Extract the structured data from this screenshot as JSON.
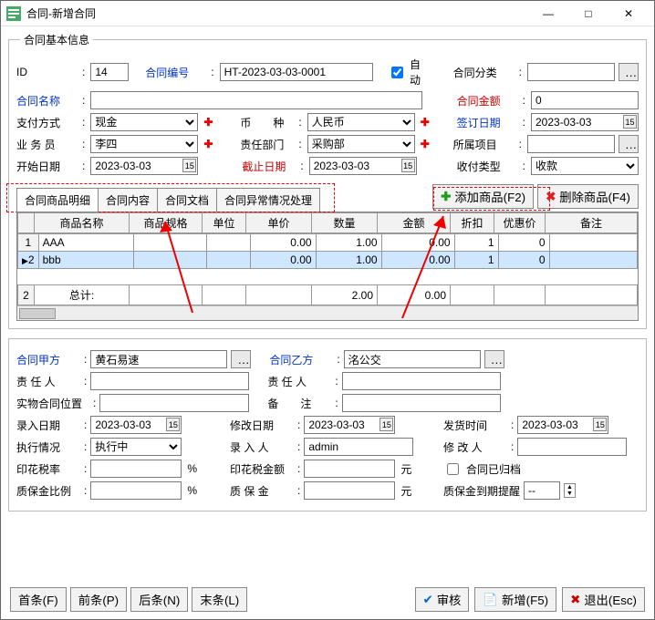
{
  "title": "合同-新增合同",
  "fieldset_title": "合同基本信息",
  "labels": {
    "id": "ID",
    "contract_no": "合同编号",
    "auto": "自动",
    "category": "合同分类",
    "name": "合同名称",
    "amount": "合同金额",
    "pay_mode": "支付方式",
    "currency": "币　　种",
    "sign_date": "签订日期",
    "salesman": "业 务 员",
    "dept": "责任部门",
    "project": "所属项目",
    "start_date": "开始日期",
    "end_date": "截止日期",
    "pay_type": "收付类型",
    "party_a": "合同甲方",
    "party_b": "合同乙方",
    "duty_a": "责 任 人",
    "duty_b": "责 任 人",
    "phys_loc": "实物合同位置",
    "remark_b": "备　　注",
    "entry_date": "录入日期",
    "modify_date": "修改日期",
    "ship_date": "发货时间",
    "exec_status": "执行情况",
    "enter_person": "录 入 人",
    "mod_person": "修 改 人",
    "stamp_rate": "印花税率",
    "stamp_amt": "印花税金额",
    "archived": "合同已归档",
    "quality_pct": "质保金比例",
    "quality_amt": "质 保 金",
    "quality_remind": "质保金到期提醒",
    "yuan": "元",
    "percent": "%"
  },
  "values": {
    "id": "14",
    "contract_no": "HT-2023-03-03-0001",
    "auto": true,
    "category": "",
    "name": "",
    "amount": "0",
    "pay_mode": "现金",
    "currency": "人民币",
    "sign_date": "2023-03-03",
    "salesman": "李四",
    "dept": "采购部",
    "project": "",
    "start_date": "2023-03-03",
    "end_date": "2023-03-03",
    "pay_type": "收款",
    "party_a": "黄石易速",
    "party_b": "洺公交",
    "entry_date": "2023-03-03",
    "modify_date": "2023-03-03",
    "ship_date": "2023-03-03",
    "exec_status": "执行中",
    "enter_person": "admin",
    "archived": false,
    "quality_remind": "--"
  },
  "tabs": [
    "合同商品明细",
    "合同内容",
    "合同文档",
    "合同异常情况处理"
  ],
  "action_buttons": {
    "add_product": "添加商品(F2)",
    "del_product": "删除商品(F4)"
  },
  "grid": {
    "cols": [
      "商品名称",
      "商品规格",
      "单位",
      "单价",
      "数量",
      "金额",
      "折扣",
      "优惠价",
      "备注"
    ],
    "rows": [
      {
        "name": "AAA",
        "spec": "",
        "unit": "",
        "price": "0.00",
        "qty": "1.00",
        "amount": "0.00",
        "discount": "1",
        "pref": "0",
        "remark": ""
      },
      {
        "name": "bbb",
        "spec": "",
        "unit": "",
        "price": "0.00",
        "qty": "1.00",
        "amount": "0.00",
        "discount": "1",
        "pref": "0",
        "remark": ""
      }
    ],
    "total_label": "总计:",
    "totals": {
      "count": "2",
      "qty": "2.00",
      "amount": "0.00"
    }
  },
  "footer": {
    "nav": [
      "首条(F)",
      "前条(P)",
      "后条(N)",
      "末条(L)"
    ],
    "audit": "审核",
    "new": "新增(F5)",
    "exit": "退出(Esc)"
  }
}
